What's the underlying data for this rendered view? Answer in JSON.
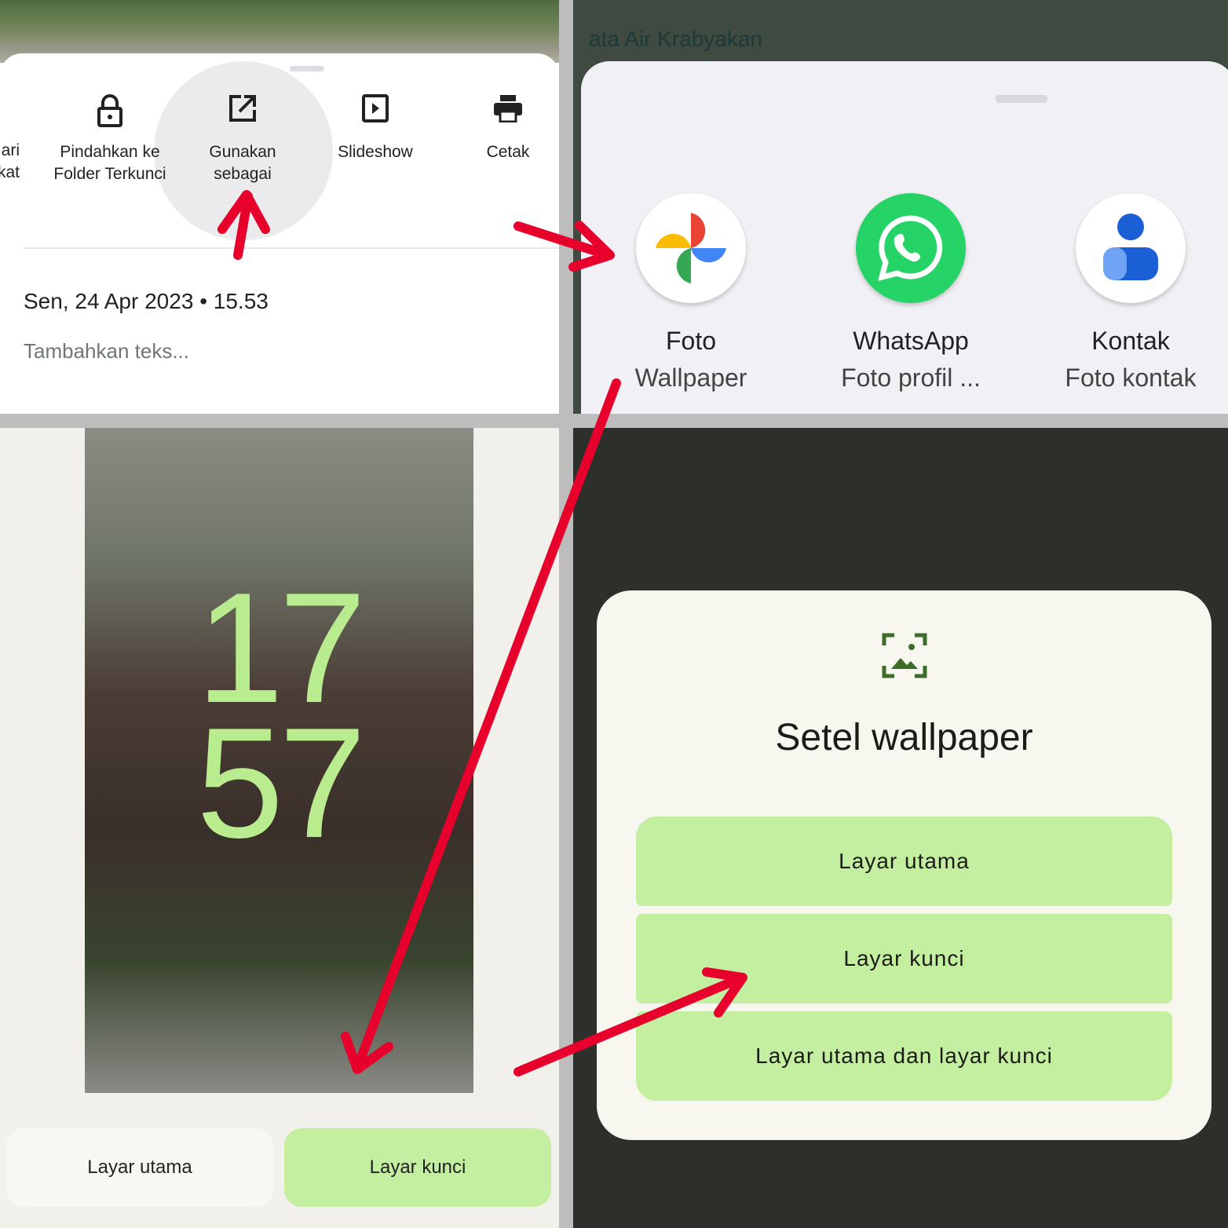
{
  "photos_sheet": {
    "actions": [
      {
        "icon": "partial-icon",
        "label": "ari\nkat"
      },
      {
        "icon": "lock-icon",
        "label": "Pindahkan ke Folder Terkunci"
      },
      {
        "icon": "open-external-icon",
        "label": "Gunakan sebagai"
      },
      {
        "icon": "slideshow-icon",
        "label": "Slideshow"
      },
      {
        "icon": "print-icon",
        "label": "Cetak"
      }
    ],
    "date": "Sen, 24 Apr 2023",
    "separator": "•",
    "time": "15.53",
    "add_text_placeholder": "Tambahkan teks..."
  },
  "share_sheet": {
    "map_label": "ata Air Krabyakan",
    "apps": [
      {
        "icon": "google-photos-icon",
        "name": "Foto",
        "action": "Wallpaper"
      },
      {
        "icon": "whatsapp-icon",
        "name": "WhatsApp",
        "action": "Foto profil ..."
      },
      {
        "icon": "contacts-icon",
        "name": "Kontak",
        "action": "Foto kontak"
      }
    ]
  },
  "preview": {
    "clock_hour": "17",
    "clock_minute": "57",
    "tabs": [
      "Layar utama",
      "Layar kunci"
    ],
    "selected_tab": "Layar kunci"
  },
  "dialog": {
    "icon": "wallpaper-icon",
    "title": "Setel wallpaper",
    "options": [
      "Layar utama",
      "Layar kunci",
      "Layar utama dan layar kunci"
    ]
  },
  "colors": {
    "accent_green": "#c5efa0",
    "arrow_red": "#e8002d",
    "clock_green": "#b9ec8e"
  }
}
